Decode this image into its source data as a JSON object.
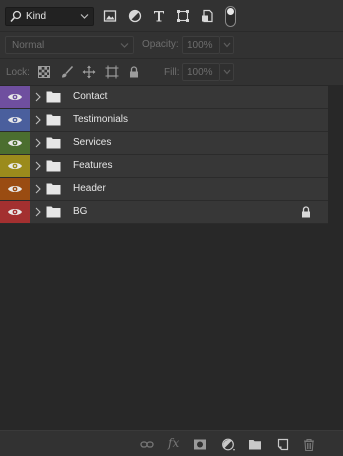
{
  "filter": {
    "kind_label": "Kind",
    "icons": [
      "pixel-layer-filter-icon",
      "adjustment-layer-filter-icon",
      "type-layer-filter-icon",
      "shape-layer-filter-icon",
      "smart-object-filter-icon",
      "filter-toggle-icon"
    ]
  },
  "blend": {
    "mode_label": "Normal",
    "opacity_label": "Opacity:",
    "opacity_value": "100%"
  },
  "lock": {
    "lock_label": "Lock:",
    "fill_label": "Fill:",
    "fill_value": "100%",
    "icons": [
      "lock-transparent-pixels-icon",
      "lock-image-pixels-icon",
      "lock-position-icon",
      "lock-artboard-icon",
      "lock-all-icon"
    ]
  },
  "layers": [
    {
      "name": "Contact",
      "color": "#6f4f9f",
      "locked": false
    },
    {
      "name": "Testimonials",
      "color": "#4a5f9d",
      "locked": false
    },
    {
      "name": "Services",
      "color": "#4b6e2f",
      "locked": false
    },
    {
      "name": "Features",
      "color": "#9b8b1c",
      "locked": false
    },
    {
      "name": "Header",
      "color": "#9a4c12",
      "locked": false
    },
    {
      "name": "BG",
      "color": "#a33030",
      "locked": true
    }
  ],
  "footer": {
    "icons": [
      "link-layers-icon",
      "layer-style-icon",
      "add-mask-icon",
      "adjustment-layer-icon",
      "new-group-icon",
      "new-layer-icon",
      "delete-layer-icon"
    ],
    "fx_label": "fx"
  },
  "colors": {
    "panel_bg": "#282828",
    "toolbar_bg": "#323232",
    "row_bg": "#373737",
    "text": "#e6e6e6",
    "muted_text": "#6e6e6e"
  }
}
